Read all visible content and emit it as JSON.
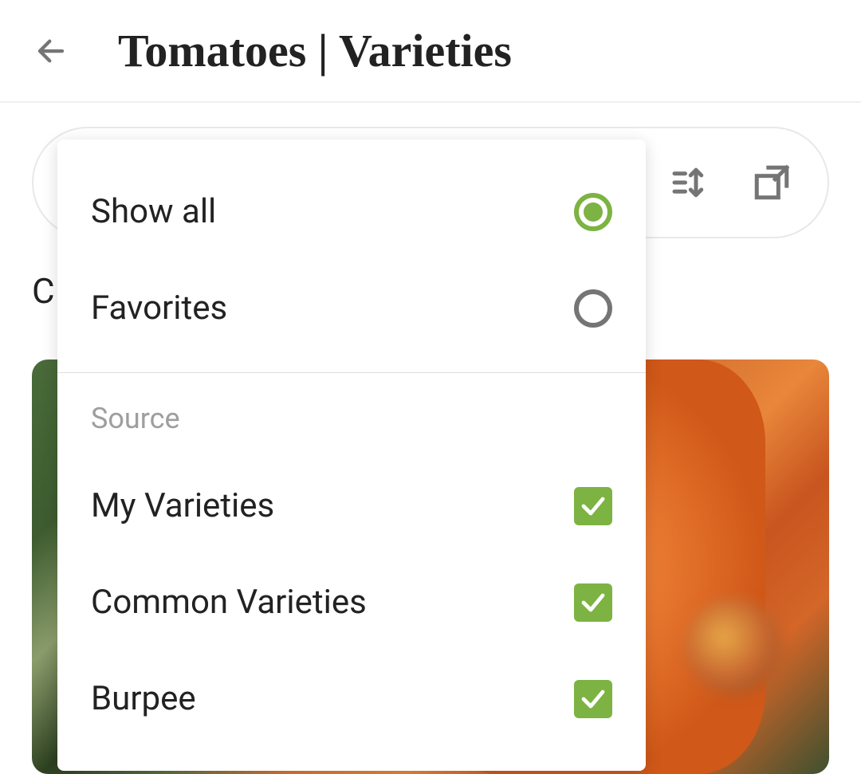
{
  "header": {
    "title": "Tomatoes | Varieties"
  },
  "section_letter": "C",
  "dropdown": {
    "radio_options": [
      {
        "label": "Show all",
        "selected": true
      },
      {
        "label": "Favorites",
        "selected": false
      }
    ],
    "section_header": "Source",
    "checkbox_options": [
      {
        "label": "My Varieties",
        "checked": true
      },
      {
        "label": "Common Varieties",
        "checked": true
      },
      {
        "label": "Burpee",
        "checked": true
      }
    ]
  },
  "colors": {
    "accent": "#7cb342",
    "icon_gray": "#757575"
  }
}
